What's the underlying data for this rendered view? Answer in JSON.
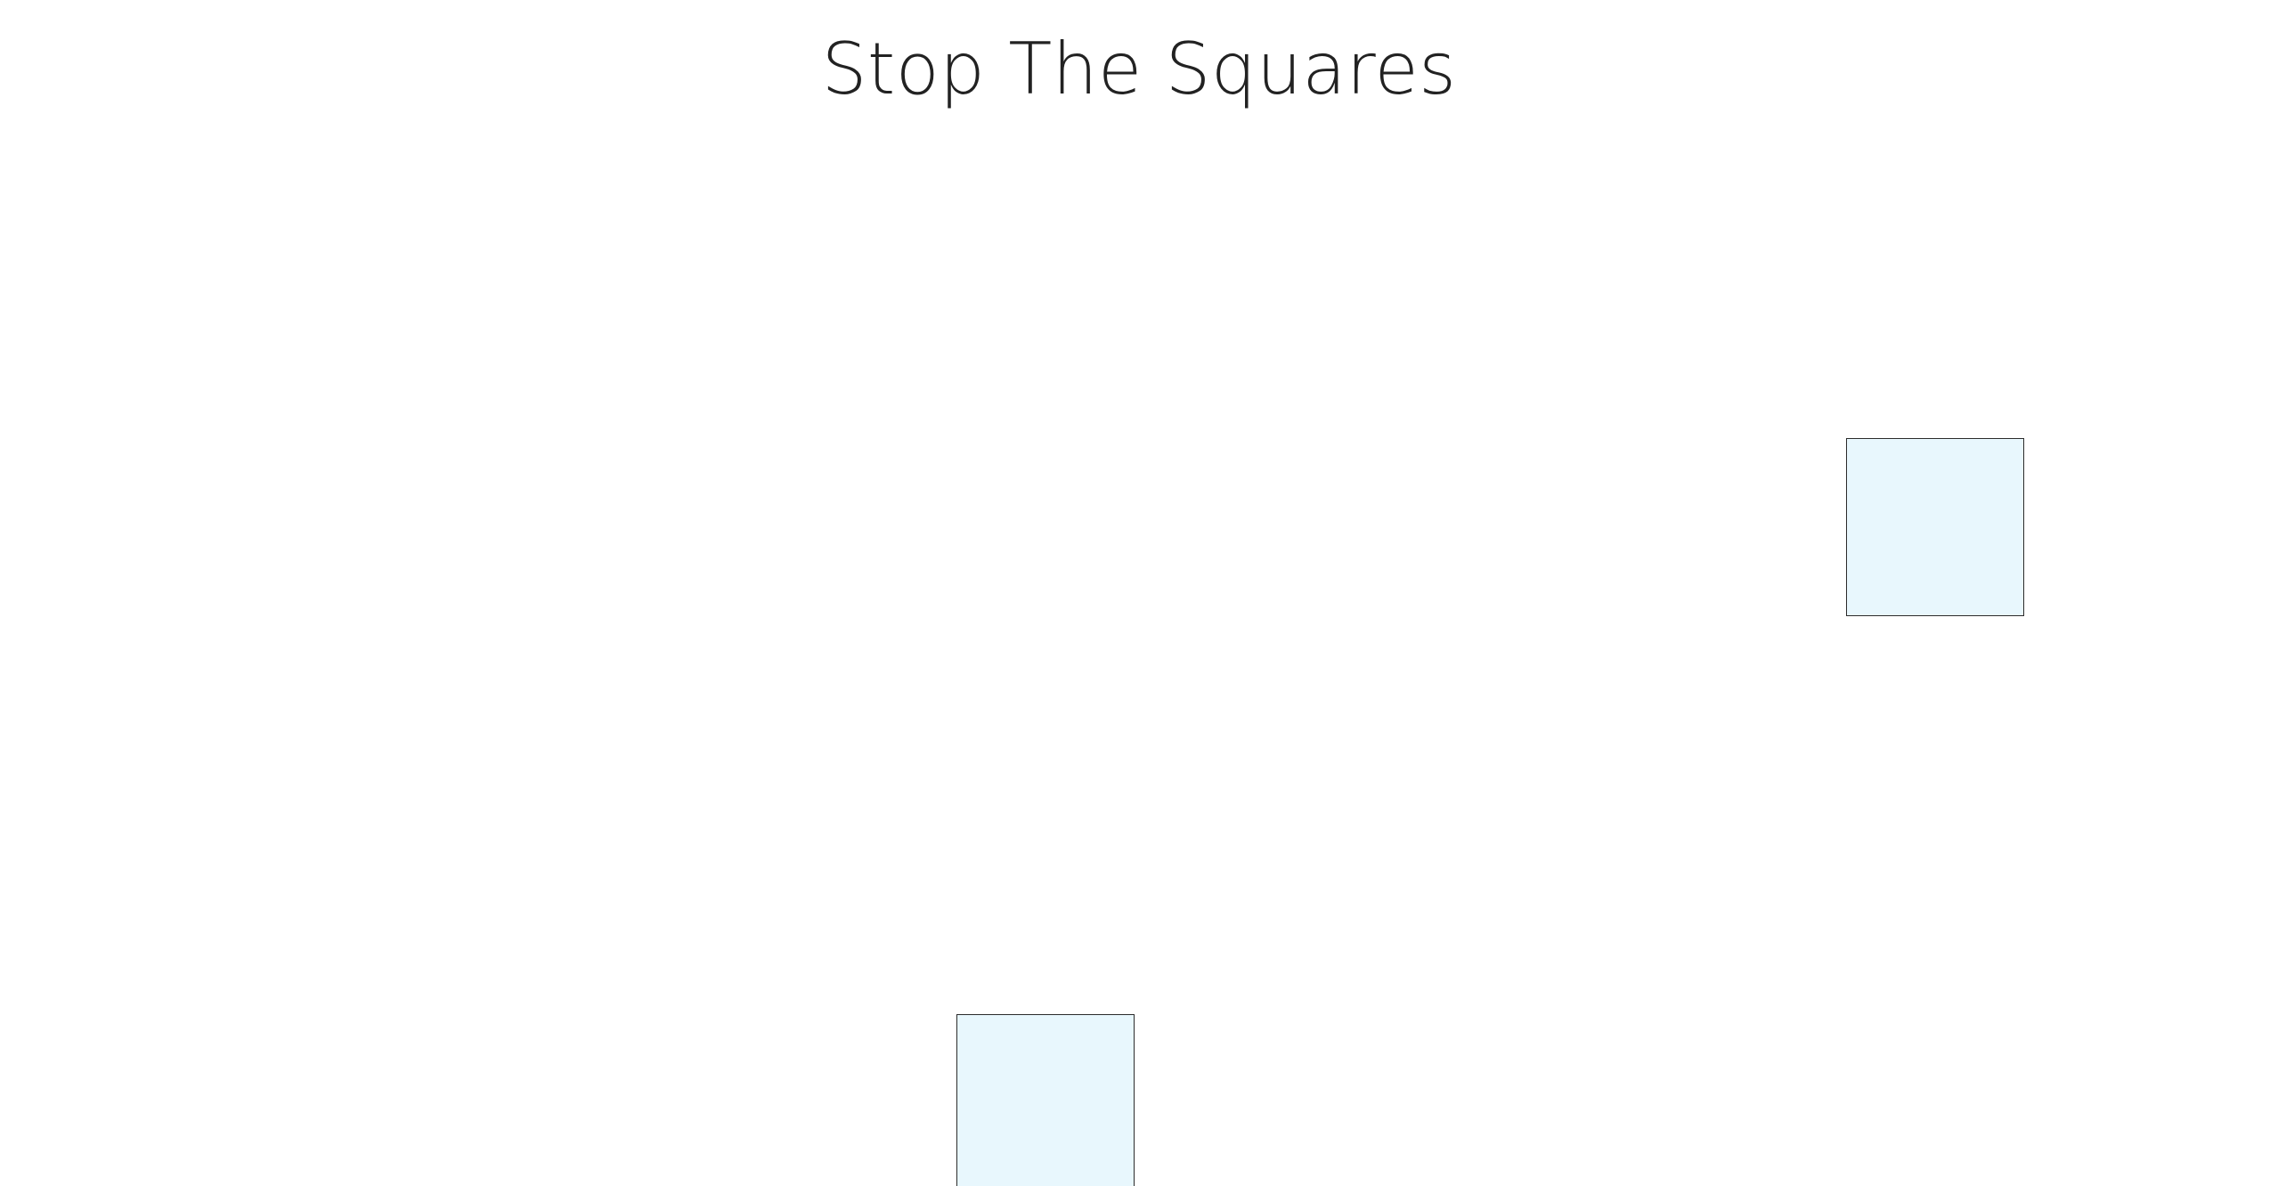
{
  "game": {
    "title": "Stop The Squares",
    "square_color": "#e8f7fd",
    "square_border_color": "#2b2b2b",
    "squares": [
      {
        "id": "square-1"
      },
      {
        "id": "square-2"
      }
    ]
  }
}
